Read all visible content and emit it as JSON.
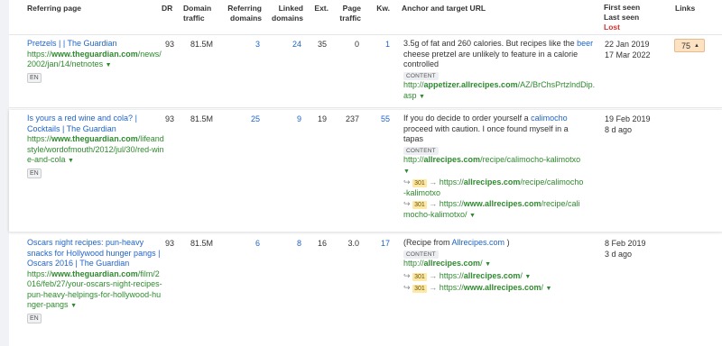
{
  "headers": {
    "referring_page": "Referring page",
    "dr": "DR",
    "domain_traffic": "Domain traffic",
    "referring_domains": "Referring domains",
    "linked_domains": "Linked domains",
    "ext": "Ext.",
    "page_traffic": "Page traffic",
    "kw": "Kw.",
    "anchor": "Anchor and target URL",
    "first_seen": "First seen",
    "last_seen": "Last seen",
    "lost": "Lost",
    "links": "Links"
  },
  "rows": [
    {
      "title": "Pretzels | | The Guardian",
      "url_prefix": "https://",
      "url_domain": "www.theguardian.com",
      "url_path": "/news/2002/jan/14/netnotes",
      "lang": "EN",
      "dr": "93",
      "domain_traffic": "81.5M",
      "referring_domains": "3",
      "linked_domains": "24",
      "ext": "35",
      "page_traffic": "0",
      "kw": "1",
      "anchor_pre": "3.5g of fat and 260 calories. But recipes like the",
      "anchor_link": "beer",
      "anchor_post": "cheese pretzel are unlikely to feature in a calorie controlled",
      "content_label": "CONTENT",
      "target_prefix": "http://",
      "target_domain": "appetizer.allrecipes.com",
      "target_path": "/AZ/BrChsPrtzlndDip.asp",
      "first_seen": "22 Jan 2019",
      "last_seen": "17 Mar 2022",
      "links": "75"
    },
    {
      "title": "Is yours a red wine and cola? | Cocktails | The Guardian",
      "url_prefix": "https://",
      "url_domain": "www.theguardian.com",
      "url_path": "/lifeandstyle/wordofmouth/2012/jul/30/red-wine-and-cola",
      "lang": "EN",
      "dr": "93",
      "domain_traffic": "81.5M",
      "referring_domains": "25",
      "linked_domains": "9",
      "ext": "19",
      "page_traffic": "237",
      "kw": "55",
      "anchor_pre": "If you do decide to order yourself a",
      "anchor_link": "calimocho",
      "anchor_post": "proceed with caution. I once found myself in a tapas",
      "content_label": "CONTENT",
      "target_prefix": "http://",
      "target_domain": "allrecipes.com",
      "target_path": "/recipe/calimocho-kalimotxo",
      "redirect_code": "301",
      "redirect1_prefix": "https://",
      "redirect1_domain": "allrecipes.com",
      "redirect1_path": "/recipe/calimocho-kalimotxo",
      "redirect2_prefix": "https://",
      "redirect2_domain": "www.allrecipes.com",
      "redirect2_path": "/recipe/calimocho-kalimotxo/",
      "first_seen": "19 Feb 2019",
      "last_seen": "8 d ago"
    },
    {
      "title": "Oscars night recipes: pun-heavy snacks for Hollywood hunger pangs | Oscars 2016 | The Guardian",
      "url_prefix": "https://",
      "url_domain": "www.theguardian.com",
      "url_path": "/film/2016/feb/27/your-oscars-night-recipes-pun-heavy-helpings-for-hollywood-hunger-pangs",
      "lang": "EN",
      "dr": "93",
      "domain_traffic": "81.5M",
      "referring_domains": "6",
      "linked_domains": "8",
      "ext": "16",
      "page_traffic": "3.0",
      "kw": "17",
      "anchor_pre": "(Recipe from",
      "anchor_link": "Allrecipes.com",
      "anchor_post": ")",
      "content_label": "CONTENT",
      "target_prefix": "http://",
      "target_domain": "allrecipes.com",
      "target_path": "/",
      "redirect_code": "301",
      "redirect1_prefix": "https://",
      "redirect1_domain": "allrecipes.com",
      "redirect1_path": "/",
      "redirect2_prefix": "https://",
      "redirect2_domain": "www.allrecipes.com",
      "redirect2_path": "/",
      "first_seen": "8 Feb 2019",
      "last_seen": "3 d ago"
    }
  ],
  "colors": {
    "link": "#1f64c7",
    "url": "#2e8a2e",
    "lost": "#d8302f",
    "redirect_badge": "#fde8a6",
    "links_badge": "#fde2c2"
  },
  "icons": {
    "caret": "caret-down-icon",
    "redirect": "redirect-arrow-icon"
  }
}
